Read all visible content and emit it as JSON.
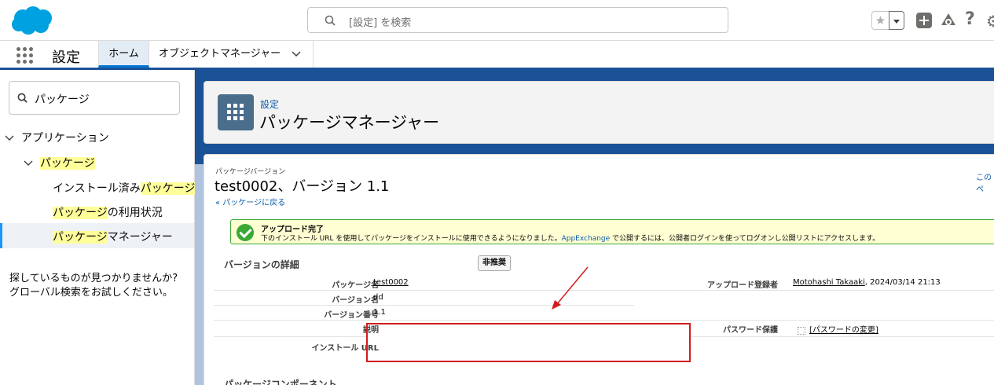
{
  "header": {
    "search_placeholder": "[設定] を検索",
    "favorites_icon": "star-icon",
    "add_icon": "plus-icon",
    "trailhead_icon": "trailhead-icon",
    "help_icon": "question-icon",
    "settings_icon": "gear-icon"
  },
  "nav": {
    "app_name": "設定",
    "tabs": [
      {
        "label": "ホーム"
      },
      {
        "label": "オブジェクトマネージャー"
      }
    ]
  },
  "sidebar": {
    "search_value": "パッケージ",
    "tree": {
      "applications": "アプリケーション",
      "packages": "パッケージ",
      "installed_prefix": "インストール済み",
      "installed_hl": "パッケージ",
      "usage_hl": "パッケージ",
      "usage_suffix": "の利用状況",
      "manager_hl": "パッケージ",
      "manager_suffix": "マネージャー"
    },
    "not_found_line1": "探しているものが見つかりませんか?",
    "not_found_line2": "グローバル検索をお試しください。"
  },
  "page_header": {
    "breadcrumb": "設定",
    "title": "パッケージマネージャー"
  },
  "detail": {
    "object_label": "パッケージバージョン",
    "title": "test0002、バージョン 1.1",
    "back_link": "« パッケージに戻る",
    "right_link": "このペ",
    "success_title": "アップロード完了",
    "success_body_before": "下のインストール URL を使用してパッケージをインストールに使用できるようになりました。",
    "success_link": "AppExchange",
    "success_body_after": " で公開するには、公開者ログインを使ってログオンし公開リストにアクセスします。",
    "section_title": "バージョンの詳細",
    "deprecate_button": "非推奨",
    "fields": {
      "package_name_label": "パッケージ名",
      "package_name_value": "test0002",
      "version_name_label": "バージョン名",
      "version_name_value": "dd",
      "version_number_label": "バージョン番号",
      "version_number_value": "1.1",
      "description_label": "説明",
      "install_url_label": "インストール URL",
      "uploaded_by_label": "アップロード登録者",
      "uploaded_by_user": "Motohashi Takaaki",
      "uploaded_by_date": ", 2024/03/14 21:13",
      "password_label": "パスワード保護",
      "password_change": "[パスワードの変更]"
    },
    "components_title": "パッケージコンポーネント"
  },
  "annotation_color": "#d21c1c"
}
